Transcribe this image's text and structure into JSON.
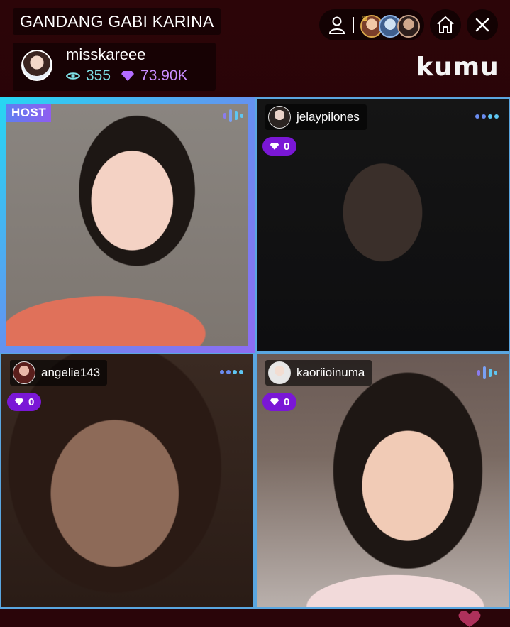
{
  "room": {
    "title": "GANDANG GABI KARINA"
  },
  "host": {
    "username": "misskareee",
    "viewers": "355",
    "gems": "73.90K"
  },
  "controls": {
    "profile_icon": "person-outline-icon",
    "home_icon": "home-icon",
    "close_icon": "close-x-icon",
    "top_viewer_avatars": [
      "viewer-1",
      "viewer-2",
      "viewer-3"
    ]
  },
  "brand": {
    "logo_text": "kumu"
  },
  "tiles": [
    {
      "badge": "HOST",
      "indicator": "audio-wave-icon"
    },
    {
      "username": "jelaypilones",
      "gems": "0",
      "indicator": "more-dots-icon"
    },
    {
      "username": "angelie143",
      "gems": "0",
      "indicator": "more-dots-icon"
    },
    {
      "username": "kaoriioinuma",
      "gems": "0",
      "indicator": "audio-wave-icon"
    }
  ],
  "colors": {
    "background": "#2a0408",
    "host_frame_start": "#26d7f2",
    "host_frame_end": "#8d6cf2",
    "guest_border": "#5aa6e0",
    "gem_pill": "#7a17d6",
    "viewers_text": "#7fe0e6",
    "gems_text": "#c98cff"
  }
}
